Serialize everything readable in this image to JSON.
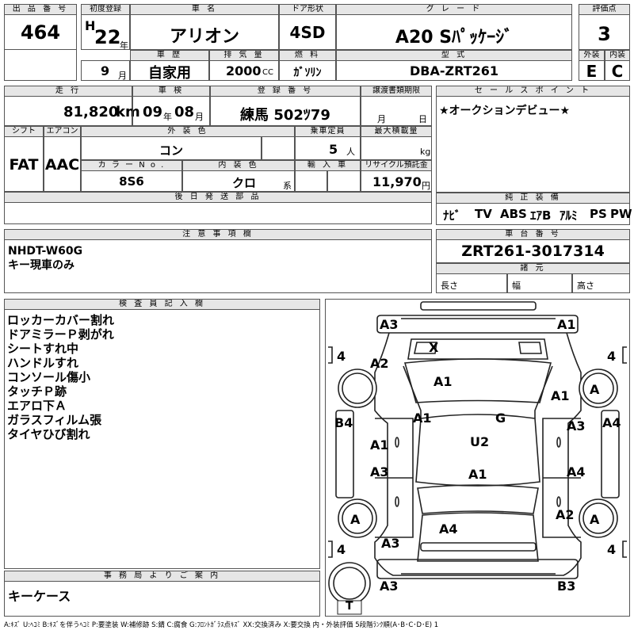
{
  "headers": {
    "lot_no": "出 品 番 号",
    "first_reg": "初度登録",
    "car_name": "車 名",
    "door": "ドア形状",
    "grade": "グ レ ー ド",
    "score": "評価点",
    "history": "車 歴",
    "displacement": "排 気 量",
    "fuel": "燃 料",
    "model": "型 式",
    "exterior": "外装",
    "interior": "内装",
    "mileage": "走 行",
    "inspection": "車 検",
    "registration": "登 録 番 号",
    "transfer": "譲渡書類期限",
    "sales_point": "セ ー ル ス ポ イ ン ト",
    "shift": "シフト",
    "aircon": "エアコン",
    "ext_color": "外 装 色",
    "capacity": "乗車定員",
    "max_load": "最大積載量",
    "color_no": "カ ラ ー N o .",
    "int_color": "内 装 色",
    "import": "輸 入 車",
    "recycle": "リサイクル預託金",
    "later_parts": "後 日 発 送 部 品",
    "equipment": "純 正 装 備",
    "notes": "注 意 事 項 欄",
    "chassis": "車 台 番 号",
    "specs": "諸 元",
    "inspector": "検 査 員 記 入 欄",
    "office": "事 務 局 よ り ご 案 内"
  },
  "lot_no": "464",
  "first_reg": {
    "era": "H",
    "year": "22",
    "year_unit": "年",
    "month": "9",
    "month_unit": "月"
  },
  "car_name": "アリオン",
  "door": "4SD",
  "grade": "A20 Sﾊﾟｯｹｰｼﾞ",
  "score": "3",
  "history": "自家用",
  "displacement": "2000",
  "displacement_unit": "CC",
  "fuel": "ｶﾞｿﾘﾝ",
  "model": "DBA-ZRT261",
  "exterior_score": "E",
  "interior_score": "C",
  "mileage": "81,820",
  "mileage_unit": "km",
  "inspection": {
    "year": "09",
    "year_unit": "年",
    "month": "08",
    "month_unit": "月"
  },
  "registration": "練馬 502ﾂ79",
  "transfer": {
    "month_unit": "月",
    "day_unit": "日"
  },
  "sales_point": "★オークションデビュー★",
  "shift": "FAT",
  "aircon": "AAC",
  "ext_color": "コン",
  "capacity": "5",
  "capacity_unit": "人",
  "max_load_unit": "kg",
  "color_no": "8S6",
  "int_color": "クロ",
  "int_color_unit": "系",
  "recycle": "11,970",
  "recycle_unit": "円",
  "equipment": [
    "ﾅﾋﾞ",
    "TV",
    "ABS",
    "ｴｱB",
    "ｱﾙﾐ",
    "PS",
    "PW"
  ],
  "notes": [
    "NHDT-W60G",
    "キー現車のみ"
  ],
  "chassis": "ZRT261-3017314",
  "specs": {
    "length": "長さ",
    "width": "幅",
    "height": "高さ"
  },
  "inspector": [
    "ロッカーカバー割れ",
    "ドアミラーＰ剥がれ",
    "シートすれ中",
    "ハンドルすれ",
    "コンソール傷小",
    "タッチＰ跡",
    "エアロ下Ａ",
    "ガラスフィルム張",
    "タイヤひび割れ"
  ],
  "office": "キーケース",
  "diagram": {
    "front_left": "A3",
    "front_right": "A1",
    "x_mark": "X",
    "fender_left": "A2",
    "hood": "A1",
    "fender_right": "A1",
    "a_pillar": "A1",
    "g_mark": "G",
    "tire_front_left": "A",
    "tire_front_right": "A",
    "rocker_left": "B4",
    "rocker_right": "A4",
    "door_fl": "A1",
    "door_fr": "A3",
    "roof": "U2",
    "door_rl": "A3",
    "center": "A1",
    "door_rr": "A4",
    "tire_rear_left": "A",
    "tire_rear_right": "A",
    "trunk": "A4",
    "quarter_right": "A2",
    "quarter_left": "A3",
    "rear_left": "A3",
    "rear_right": "B3",
    "tire_depth_fl": "4",
    "tire_depth_fr": "4",
    "tire_depth_rl": "4",
    "tire_depth_rr": "4",
    "spare": "T"
  },
  "legend": "A:ｷｽﾞ U:ﾍｺﾐ B:ｷｽﾞを伴うﾍｺﾐ P:要塗装 W:補修跡 S:錆 C:腐食 G:ﾌﾛﾝﾄｶﾞﾗｽ点ｷｽﾞ XX:交換済み X:要交換 内・外装評価 5段階ﾗﾝｸ順(A･B･C･D･E) 1"
}
